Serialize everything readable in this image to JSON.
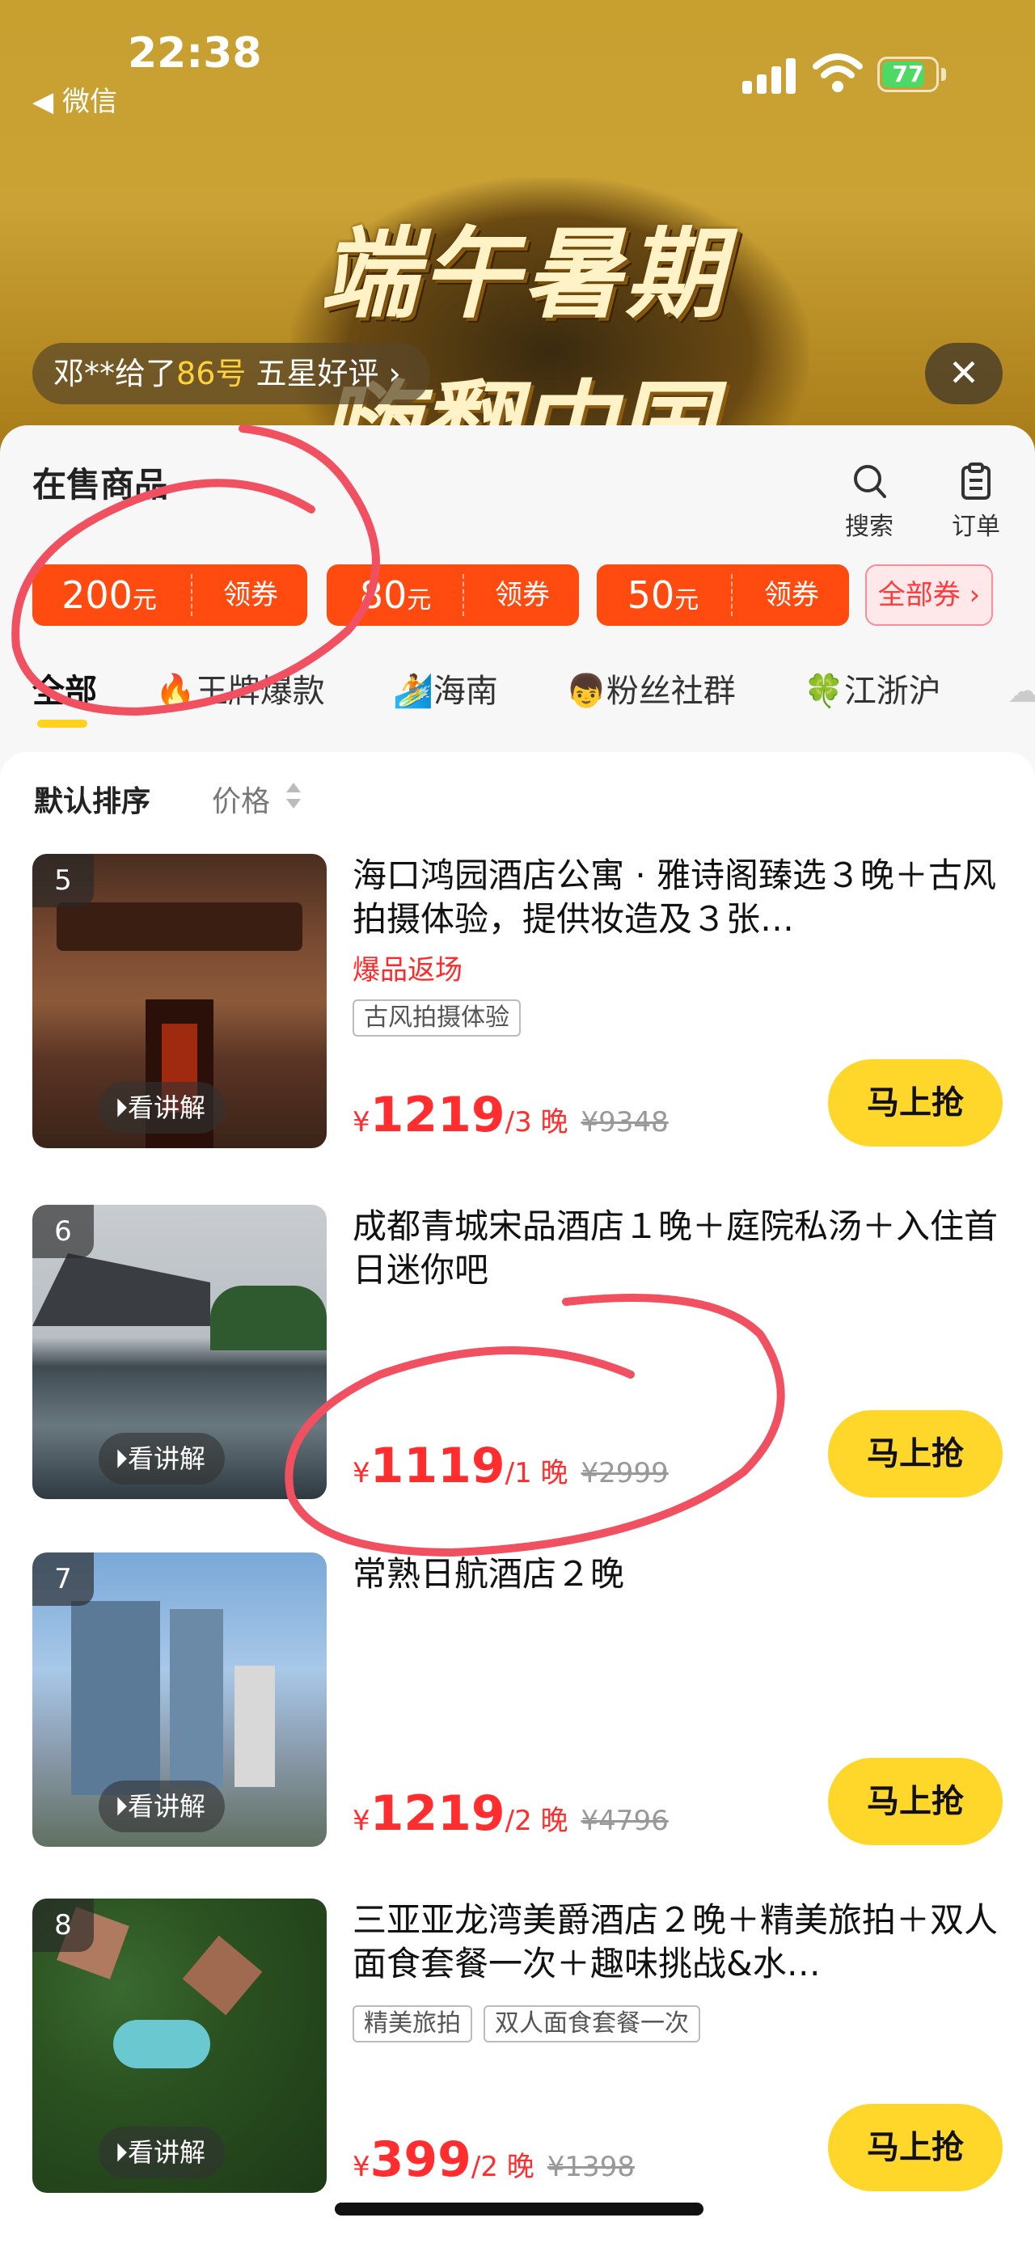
{
  "status_bar": {
    "time": "22:38",
    "back_label": "◀ 微信",
    "battery": "77"
  },
  "banner": {
    "line1": "端午暑期",
    "line2": "嗨翻中国"
  },
  "review_ticker": {
    "prefix": "邓**给了",
    "highlight": "86号",
    "suffix": "五星好评 ›"
  },
  "header": {
    "title": "在售商品",
    "search_label": "搜索",
    "orders_label": "订单"
  },
  "coupons": [
    {
      "amount": "200",
      "unit": "元",
      "action": "领券"
    },
    {
      "amount": "80",
      "unit": "元",
      "action": "领券"
    },
    {
      "amount": "50",
      "unit": "元",
      "action": "领券"
    }
  ],
  "all_coupons_label": "全部券 ›",
  "tabs": [
    {
      "label": "全部",
      "icon": ""
    },
    {
      "label": "王牌爆款",
      "icon": "🔥"
    },
    {
      "label": "海南",
      "icon": "🏄"
    },
    {
      "label": "粉丝社群",
      "icon": "👦"
    },
    {
      "label": "江浙沪",
      "icon": "🍀"
    }
  ],
  "sort": {
    "default_label": "默认排序",
    "price_label": "价格"
  },
  "products": [
    {
      "rank": "5",
      "title": "海口鸿园酒店公寓 · 雅诗阁臻选３晚＋古风拍摄体验，提供妆造及３张…",
      "subtitle": "爆品返场",
      "tags": [
        "古风拍摄体验"
      ],
      "yen": "¥",
      "price": "1219",
      "per": "/3 晚",
      "original": "¥9348",
      "explain_label": "看讲解",
      "buy_label": "马上抢"
    },
    {
      "rank": "6",
      "title": "成都青城宋品酒店１晚＋庭院私汤＋入住首日迷你吧",
      "subtitle": "",
      "tags": [],
      "yen": "¥",
      "price": "1119",
      "per": "/1 晚",
      "original": "¥2999",
      "explain_label": "看讲解",
      "buy_label": "马上抢"
    },
    {
      "rank": "7",
      "title": "常熟日航酒店２晚",
      "subtitle": "",
      "tags": [],
      "yen": "¥",
      "price": "1219",
      "per": "/2 晚",
      "original": "¥4796",
      "explain_label": "看讲解",
      "buy_label": "马上抢"
    },
    {
      "rank": "8",
      "title": "三亚亚龙湾美爵酒店２晚＋精美旅拍＋双人面食套餐一次＋趣味挑战&水…",
      "subtitle": "",
      "tags": [
        "精美旅拍",
        "双人面食套餐一次"
      ],
      "yen": "¥",
      "price": "399",
      "per": "/2 晚",
      "original": "¥1398",
      "explain_label": "看讲解",
      "buy_label": "马上抢"
    }
  ],
  "colors": {
    "accent": "#ff4a10",
    "price": "#ff2d2d",
    "buy_button": "#ffd72a",
    "annotation": "#f05060"
  }
}
